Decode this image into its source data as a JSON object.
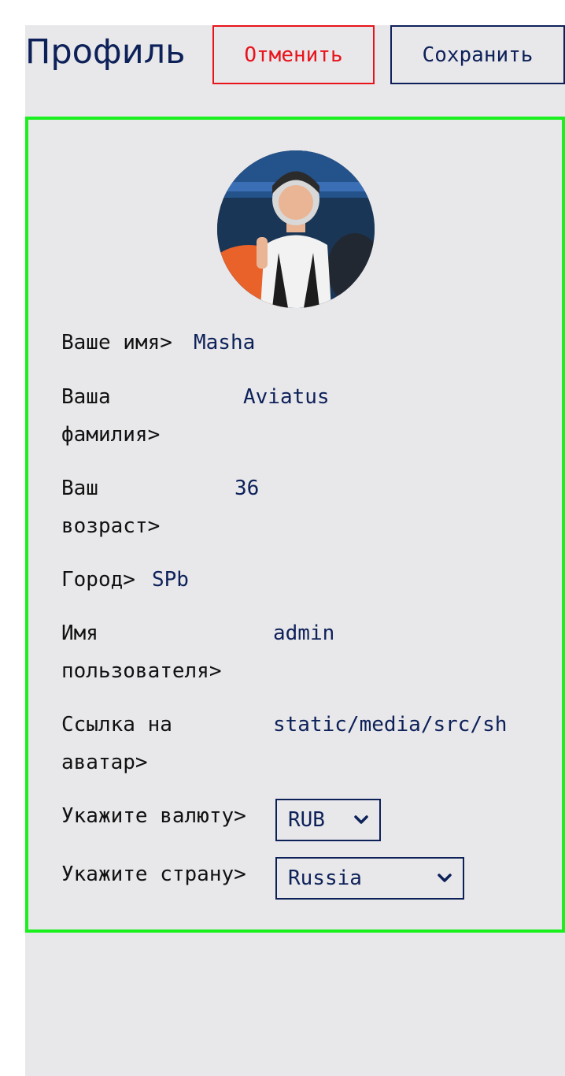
{
  "header": {
    "title": "Профиль",
    "cancel_label": "Отменить",
    "save_label": "Сохранить"
  },
  "profile": {
    "first_name_label": "Ваше имя>",
    "first_name_value": "Masha",
    "last_name_label": "Ваша\nфамилия>",
    "last_name_value": "Aviatus",
    "age_label": "Ваш\nвозраст>",
    "age_value": "36",
    "city_label": "Город>",
    "city_value": "SPb",
    "username_label": "Имя\nпользователя>",
    "username_value": "admin",
    "avatar_link_label": "Ссылка на\nаватар>",
    "avatar_link_value": "static/media/src/sh",
    "currency_label": "Укажите валюту>",
    "currency_value": "RUB",
    "country_label": "Укажите страну>",
    "country_value": "Russia"
  },
  "colors": {
    "accent": "#0d2159",
    "cancel": "#e8131b",
    "card_border": "#19f01e",
    "background": "#e8e7ea"
  },
  "icons": {
    "avatar": "skydiver-photo",
    "select_arrow": "chevron-down-icon"
  }
}
